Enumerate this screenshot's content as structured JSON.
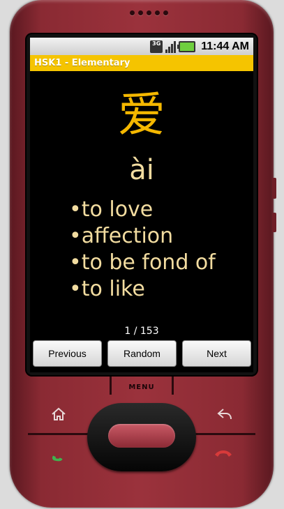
{
  "status_bar": {
    "network_label": "3G",
    "time": "11:44 AM",
    "icons": [
      "3g-icon",
      "signal-icon",
      "battery-icon"
    ]
  },
  "app": {
    "title": "HSK1 - Elementary",
    "accent_color": "#f5c400"
  },
  "card": {
    "hanzi": "爱",
    "pinyin": "ài",
    "meanings": [
      "to love",
      "affection",
      "to be fond of",
      "to like"
    ],
    "counter": "1 / 153"
  },
  "buttons": {
    "previous": "Previous",
    "random": "Random",
    "next": "Next"
  },
  "hardware": {
    "menu_label": "MENU",
    "keys": [
      "home-icon",
      "back-icon",
      "call-icon",
      "end-call-icon"
    ]
  }
}
